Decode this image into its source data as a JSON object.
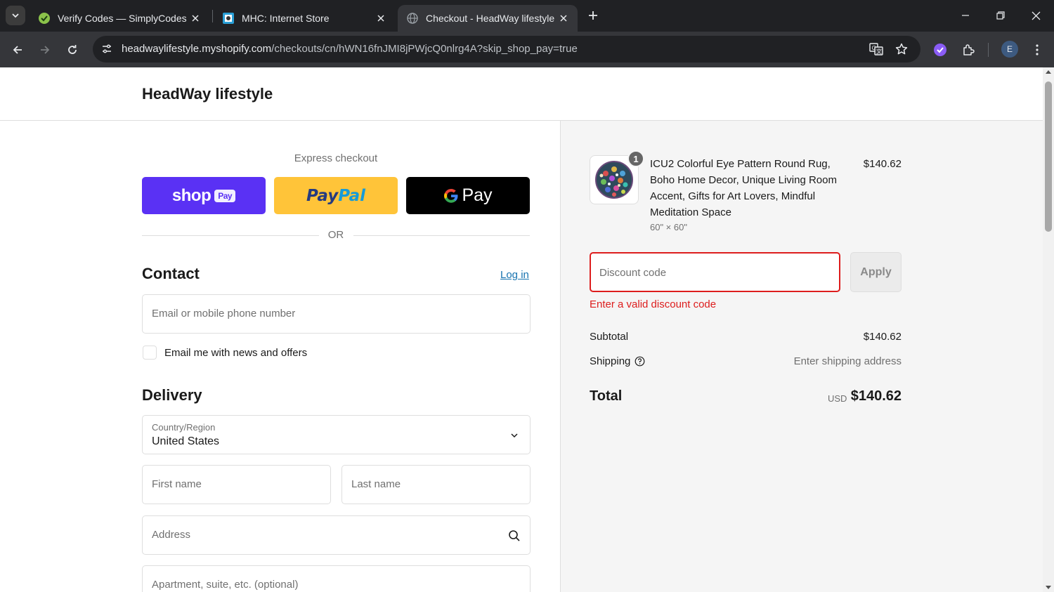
{
  "browser": {
    "tabs": [
      {
        "title": "Verify Codes — SimplyCodes",
        "icon": "simplycodes-icon"
      },
      {
        "title": "MHC: Internet Store",
        "icon": "mhc-icon"
      },
      {
        "title": "Checkout - HeadWay lifestyle",
        "icon": "globe-icon",
        "active": true
      }
    ],
    "url": {
      "host": "headwaylifestyle.myshopify.com",
      "path": "/checkouts/cn/hWN16fnJMI8jPWjcQ0nlrg4A?skip_shop_pay=true"
    },
    "profile_initial": "E"
  },
  "store": {
    "name": "HeadWay lifestyle"
  },
  "express": {
    "label": "Express checkout",
    "shop_pay": {
      "word": "shop",
      "badge": "Pay"
    },
    "paypal": {
      "part1": "Pay",
      "part2": "Pal"
    },
    "gpay": {
      "word": "Pay"
    },
    "or_label": "OR"
  },
  "contact": {
    "title": "Contact",
    "login_link": "Log in",
    "email_placeholder": "Email or mobile phone number",
    "newsletter_label": "Email me with news and offers",
    "newsletter_checked": false
  },
  "delivery": {
    "title": "Delivery",
    "country_label": "Country/Region",
    "country_value": "United States",
    "first_name_placeholder": "First name",
    "last_name_placeholder": "Last name",
    "address_placeholder": "Address",
    "apartment_placeholder": "Apartment, suite, etc. (optional)"
  },
  "summary": {
    "item": {
      "quantity": "1",
      "name": "ICU2 Colorful Eye Pattern Round Rug, Boho Home Decor, Unique Living Room Accent, Gifts for Art Lovers, Mindful Meditation Space",
      "variant": "60\" × 60\"",
      "price": "$140.62"
    },
    "discount_placeholder": "Discount code",
    "apply_label": "Apply",
    "discount_error": "Enter a valid discount code",
    "subtotal_label": "Subtotal",
    "subtotal_value": "$140.62",
    "shipping_label": "Shipping",
    "shipping_value": "Enter shipping address",
    "total_label": "Total",
    "total_currency": "USD",
    "total_value": "$140.62"
  },
  "colors": {
    "error": "#dd1d1d",
    "link": "#1773b0",
    "shop_pay": "#5a31f4",
    "paypal": "#ffc439",
    "gpay": "#000000"
  }
}
